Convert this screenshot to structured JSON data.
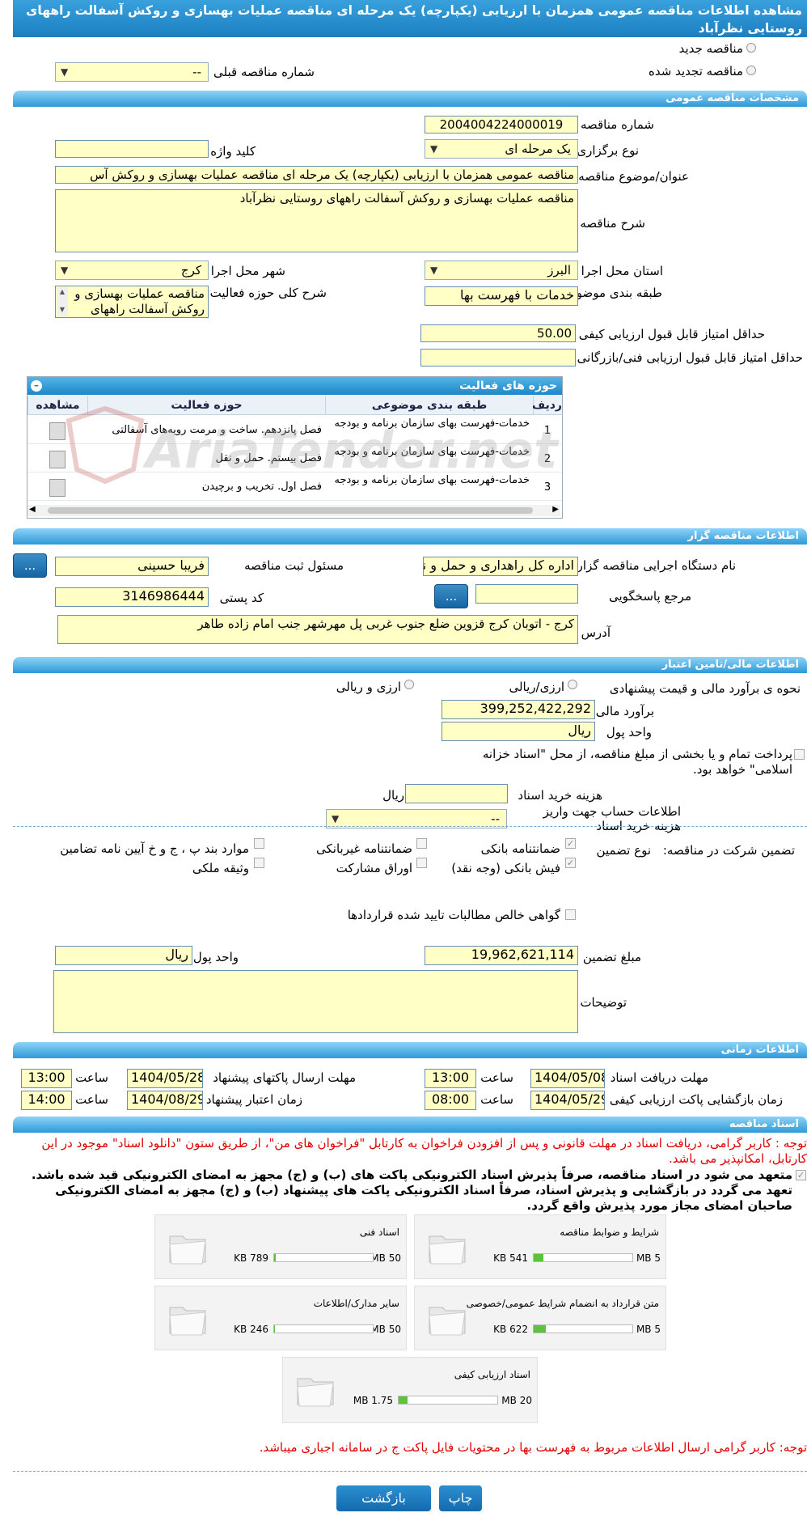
{
  "title": "مشاهده اطلاعات مناقصه عمومی همزمان با ارزیابی (یکپارچه) یک مرحله ای مناقصه عملیات بهسازی و روکش آسفالت راههای روستایی نظرآباد",
  "tender_kind": {
    "new_label": "مناقصه جدید",
    "renewed_label": "مناقصه تجدید شده",
    "prev_number_label": "شماره مناقصه قبلی",
    "prev_number_value": "--"
  },
  "sections": {
    "general": "مشخصات مناقصه عمومی",
    "organizer": "اطلاعات مناقصه گزار",
    "financial": "اطلاعات مالی/تامین اعتبار",
    "timing": "اطلاعات زمانی",
    "documents": "اسناد مناقصه"
  },
  "general": {
    "number_label": "شماره مناقصه",
    "number": "2004004224000019",
    "type_label": "نوع برگزاری",
    "type": "یک مرحله ای",
    "keyword_label": "کلید واژه",
    "keyword": "",
    "subject_label": "عنوان/موضوع مناقصه",
    "subject": "مناقصه عمومی همزمان با ارزیابی (یکپارچه) یک مرحله ای مناقصه عملیات بهسازی و روکش آس",
    "desc_label": "شرح مناقصه",
    "desc": "مناقصه عملیات بهسازی و روکش آسفالت راههای روستایی نظرآباد",
    "province_label": "استان محل اجرا",
    "province": "البرز",
    "city_label": "شهر محل اجرا",
    "city": "کرج",
    "category_label": "طبقه بندی موضوعی",
    "category": "خدمات با فهرست بها",
    "scope_label": "شرح کلی حوزه فعالیت",
    "scope": "مناقصه عملیات بهسازی و روکش آسفالت راههای",
    "min_quality_label": "حداقل امتیاز قابل قبول ارزیابی کیفی",
    "min_quality": "50.00",
    "min_tech_label": "حداقل امتیاز قابل قبول ارزیابی فنی/بازرگانی",
    "min_tech": ""
  },
  "activities": {
    "header": "حوزه های فعالیت",
    "columns": [
      "ردیف",
      "طبقه بندی موضوعی",
      "حوزه فعالیت",
      "مشاهده"
    ],
    "rows": [
      {
        "idx": "1",
        "category": "خدمات-فهرست بهای سازمان برنامه و بودجه",
        "field": "فصل پانزدهم. ساخت و مرمت رویه‌های آسفالتی"
      },
      {
        "idx": "2",
        "category": "خدمات-فهرست بهای سازمان برنامه و بودجه",
        "field": "فصل بیستم. حمل و نقل"
      },
      {
        "idx": "3",
        "category": "خدمات-فهرست بهای سازمان برنامه و بودجه",
        "field": "فصل اول. تخریب و برچیدن"
      }
    ]
  },
  "organizer": {
    "agency_label": "نام دستگاه اجرایی مناقصه گزار",
    "agency": "اداره کل راهداری و حمل و نقل",
    "registrar_label": "مسئول ثبت مناقصه",
    "registrar": "فریبا حسینی",
    "responder_label": "مرجع پاسخگویی",
    "responder": "",
    "postal_label": "کد پستی",
    "postal": "3146986444",
    "address_label": "آدرس",
    "address": "کرج - اتوبان کرج قزوین ضلع جنوب غربی پل مهرشهر جنب امام زاده طاهر",
    "dots": "..."
  },
  "financial": {
    "estimate_kind_label": "نحوه ی برآورد مالی و قیمت پیشنهادی",
    "opt_rial": "ارزی/ریالی",
    "opt_fx": "ارزی و ریالی",
    "estimate_label": "برآورد مالی",
    "estimate": "399,252,422,292",
    "currency_label": "واحد پول",
    "currency": "ریال",
    "treasury_text": "پرداخت تمام و یا بخشی از مبلغ مناقصه، از محل \"اسناد خزانه اسلامی\" خواهد بود.",
    "doc_fee_label": "هزینه خرید اسناد",
    "doc_fee": "",
    "doc_fee_unit": "ریال",
    "account_label": "اطلاعات حساب جهت واریز هزینه خرید اسناد",
    "account": "--",
    "guarantee_label": "تضمین شرکت در مناقصه:",
    "guarantee_type_label": "نوع تضمین",
    "g_bank": "ضمانتنامه بانکی",
    "g_nonbank": "ضمانتنامه غیربانکی",
    "g_items": "موارد بند پ ، ج و خ آیین نامه تضامین",
    "g_cash": "فیش بانکی (وجه نقد)",
    "g_bonds": "اوراق مشارکت",
    "g_property": "وثیقه ملکی",
    "g_claims": "گواهی خالص مطالبات تایید شده قراردادها",
    "guarantee_amount_label": "مبلغ تضمین",
    "guarantee_amount": "19,962,621,114",
    "guarantee_currency_label": "واحد پول",
    "guarantee_currency": "ریال",
    "notes_label": "توضیحات",
    "notes": ""
  },
  "timing": {
    "receive_label": "مهلت دریافت اسناد",
    "receive_date": "1404/05/08",
    "receive_time": "13:00",
    "submit_label": "مهلت ارسال پاکتهای پیشنهاد",
    "submit_date": "1404/05/28",
    "submit_time": "13:00",
    "open_label": "زمان بازگشایی پاکت ارزیابی کیفی",
    "open_date": "1404/05/29",
    "open_time": "08:00",
    "valid_label": "زمان اعتبار پیشنهاد",
    "valid_date": "1404/08/29",
    "valid_time": "14:00",
    "time_label": "ساعت"
  },
  "documents": {
    "note": "توجه : کاربر گرامی، دریافت اسناد در مهلت قانونی و پس از افزودن فراخوان به کارتابل \"فراخوان های من\"، از طریق ستون \"دانلود اسناد\" موجود در این کارتابل، امکانپذیر می باشد.",
    "commit": "متعهد می شود در اسناد مناقصه، صرفاً پذیرش اسناد الکترونیکی پاکت های (ب) و (ج) مجهز به امضای الکترونیکی قید شده باشد. تعهد می گردد در بازگشایی و پذیرش اسناد، صرفاً اسناد الکترونیکی پاکت های پیشنهاد (ب) و (ج) مجهز به امضای الکترونیکی صاحبان امضای مجاز مورد پذیرش واقع گردد.",
    "items": [
      {
        "name": "شرایط و ضوابط مناقصه",
        "size": "541 KB",
        "max": "5 MB",
        "pct": 0.1
      },
      {
        "name": "اسناد فنی",
        "size": "789 KB",
        "max": "50 MB",
        "pct": 0.02
      },
      {
        "name": "متن قرارداد به انضمام شرایط عمومی/خصوصی",
        "size": "622 KB",
        "max": "5 MB",
        "pct": 0.12
      },
      {
        "name": "سایر مدارک/اطلاعات",
        "size": "246 KB",
        "max": "50 MB",
        "pct": 0.01
      },
      {
        "name": "اسناد ارزیابی کیفی",
        "size": "1.75 MB",
        "max": "20 MB",
        "pct": 0.09
      }
    ],
    "footer_note": "توجه: کاربر گرامی ارسال اطلاعات مربوط به فهرست بها در محتویات فایل پاکت ج در سامانه اجباری میباشد."
  },
  "buttons": {
    "back": "بازگشت",
    "print": "چاپ"
  },
  "watermark": "AriaTender.net"
}
